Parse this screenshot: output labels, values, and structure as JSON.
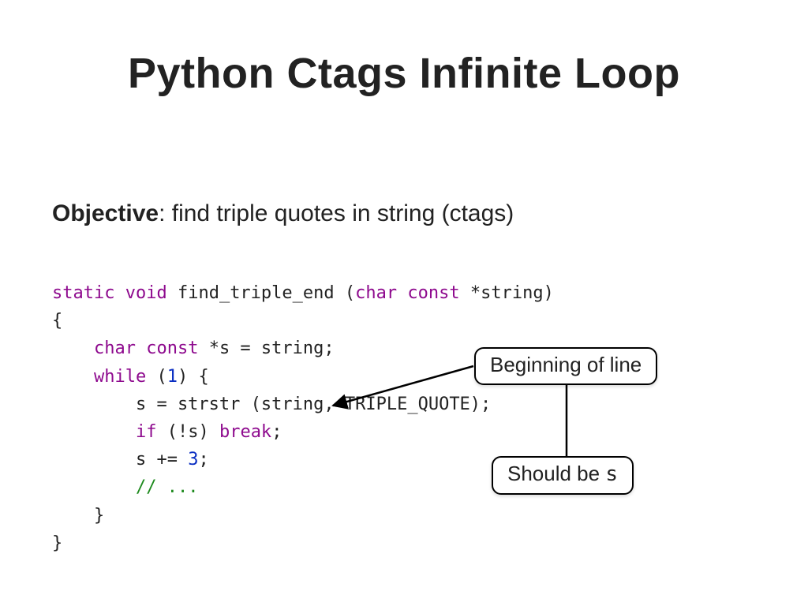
{
  "title": "Python Ctags Infinite Loop",
  "objective": {
    "label": "Objective",
    "text": ":  find triple quotes in string (ctags)"
  },
  "code": {
    "l1": {
      "kw1": "static",
      "kw2": "void",
      "fn": " find_triple_end (",
      "kw3": "char",
      "kw4": "const",
      "rest": " *string)"
    },
    "l2": "{",
    "l3": {
      "indent": "    ",
      "kw1": "char",
      "kw2": "const",
      "rest": " *s = string;"
    },
    "l4": {
      "indent": "    ",
      "kw": "while",
      "open": " (",
      "num": "1",
      "close": ") {"
    },
    "l5": "        s = strstr (string, TRIPLE_QUOTE);",
    "l6": {
      "indent": "        ",
      "kw1": "if",
      "mid": " (!s) ",
      "kw2": "break",
      "end": ";"
    },
    "l7": {
      "indent": "        s += ",
      "num": "3",
      "end": ";"
    },
    "l8": {
      "indent": "        ",
      "cm": "// ..."
    },
    "l9": "    }",
    "l10": "}"
  },
  "callouts": {
    "top": "Beginning of line",
    "bottom_pre": "Should be ",
    "bottom_code": "s"
  }
}
